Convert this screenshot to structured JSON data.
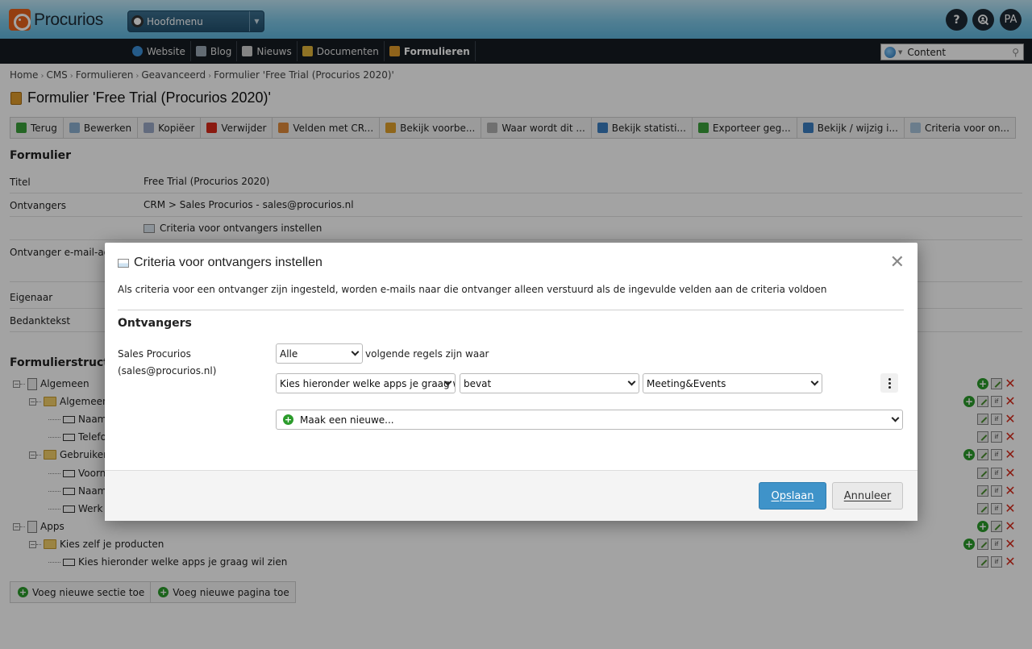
{
  "header": {
    "brand": "Procurios",
    "main_menu": "Hoofdmenu",
    "help_icon": "?",
    "user_initials": "PA"
  },
  "nav": {
    "items": [
      {
        "label": "Website",
        "icon": "globe-icon",
        "color": "#3b8fd6"
      },
      {
        "label": "Blog",
        "icon": "blog-icon",
        "color": "#9aa8b5"
      },
      {
        "label": "Nieuws",
        "icon": "news-icon",
        "color": "#cfcfcf"
      },
      {
        "label": "Documenten",
        "icon": "documents-icon",
        "color": "#e0b43a"
      },
      {
        "label": "Formulieren",
        "icon": "forms-icon",
        "color": "#e09b2b"
      }
    ],
    "search": {
      "scope": "Content"
    }
  },
  "breadcrumb": [
    "Home",
    "CMS",
    "Formulieren",
    "Geavanceerd",
    "Formulier 'Free Trial (Procurios 2020)'"
  ],
  "page_title": "Formulier 'Free Trial (Procurios 2020)'",
  "toolbar": [
    {
      "label": "Terug",
      "icon": "back-arrow-icon",
      "color": "#3aa03a"
    },
    {
      "label": "Bewerken",
      "icon": "edit-icon",
      "color": "#8bb0d0"
    },
    {
      "label": "Kopiëer",
      "icon": "copy-icon",
      "color": "#9aa8c5"
    },
    {
      "label": "Verwijder",
      "icon": "delete-icon",
      "color": "#d8291a"
    },
    {
      "label": "Velden met CR...",
      "icon": "users-icon",
      "color": "#e08a3a"
    },
    {
      "label": "Bekijk voorbe...",
      "icon": "preview-icon",
      "color": "#e0a02b"
    },
    {
      "label": "Waar wordt dit ...",
      "icon": "link-icon",
      "color": "#b0b0b0"
    },
    {
      "label": "Bekijk statisti...",
      "icon": "statistics-icon",
      "color": "#3a7ec0"
    },
    {
      "label": "Exporteer geg...",
      "icon": "export-icon",
      "color": "#3aa03a"
    },
    {
      "label": "Bekijk / wijzig i...",
      "icon": "calendar-icon",
      "color": "#3a7ec0"
    },
    {
      "label": "Criteria voor on...",
      "icon": "criteria-icon",
      "color": "#a8c4dc"
    }
  ],
  "form": {
    "heading": "Formulier",
    "rows": [
      {
        "label": "Titel",
        "value": "Free Trial (Procurios 2020)"
      },
      {
        "label": "Ontvangers",
        "value": "CRM > Sales Procurios - sales@procurios.nl"
      },
      {
        "label": "",
        "value": "Criteria voor ontvangers instellen"
      },
      {
        "label": "Ontvanger e-mail-adr",
        "value": ""
      },
      {
        "label": "Eigenaar",
        "value": ""
      },
      {
        "label": "Bedanktekst",
        "value": ""
      }
    ]
  },
  "structure": {
    "heading": "Formulierstructuu",
    "rows": [
      {
        "label": "Algemeen",
        "kind": "page",
        "indent": 0
      },
      {
        "label": "Algemeen",
        "kind": "folder",
        "indent": 1
      },
      {
        "label": "Naam",
        "kind": "field",
        "indent": 2
      },
      {
        "label": "Telefo",
        "kind": "field",
        "indent": 2
      },
      {
        "label": "Gebruiker",
        "kind": "folder",
        "indent": 1
      },
      {
        "label": "Voorn",
        "kind": "field",
        "indent": 2
      },
      {
        "label": "Naam",
        "kind": "field",
        "indent": 2
      },
      {
        "label": "Werk",
        "kind": "field",
        "indent": 2
      },
      {
        "label": "Apps",
        "kind": "page",
        "indent": 0
      },
      {
        "label": "Kies zelf je producten",
        "kind": "folder",
        "indent": 1
      },
      {
        "label": "Kies hieronder welke apps je graag wil zien",
        "kind": "field",
        "indent": 2
      }
    ],
    "add_section": "Voeg nieuwe sectie toe",
    "add_page": "Voeg nieuwe pagina toe"
  },
  "modal": {
    "title": "Criteria voor ontvangers instellen",
    "description": "Als criteria voor een ontvanger zijn ingesteld, worden e-mails naar die ontvanger alleen verstuurd als de ingevulde velden aan de criteria voldoen",
    "section": "Ontvangers",
    "recipient_name": "Sales Procurios",
    "recipient_email": "(sales@procurios.nl)",
    "match_mode": "Alle",
    "match_suffix": "volgende regels zijn waar",
    "rule": {
      "field": "Kies hieronder welke apps je graag wil zien",
      "operator": "bevat",
      "value": "Meeting&Events"
    },
    "add_new": "Maak een nieuwe...",
    "save": "Opslaan",
    "cancel": "Annuleer"
  }
}
